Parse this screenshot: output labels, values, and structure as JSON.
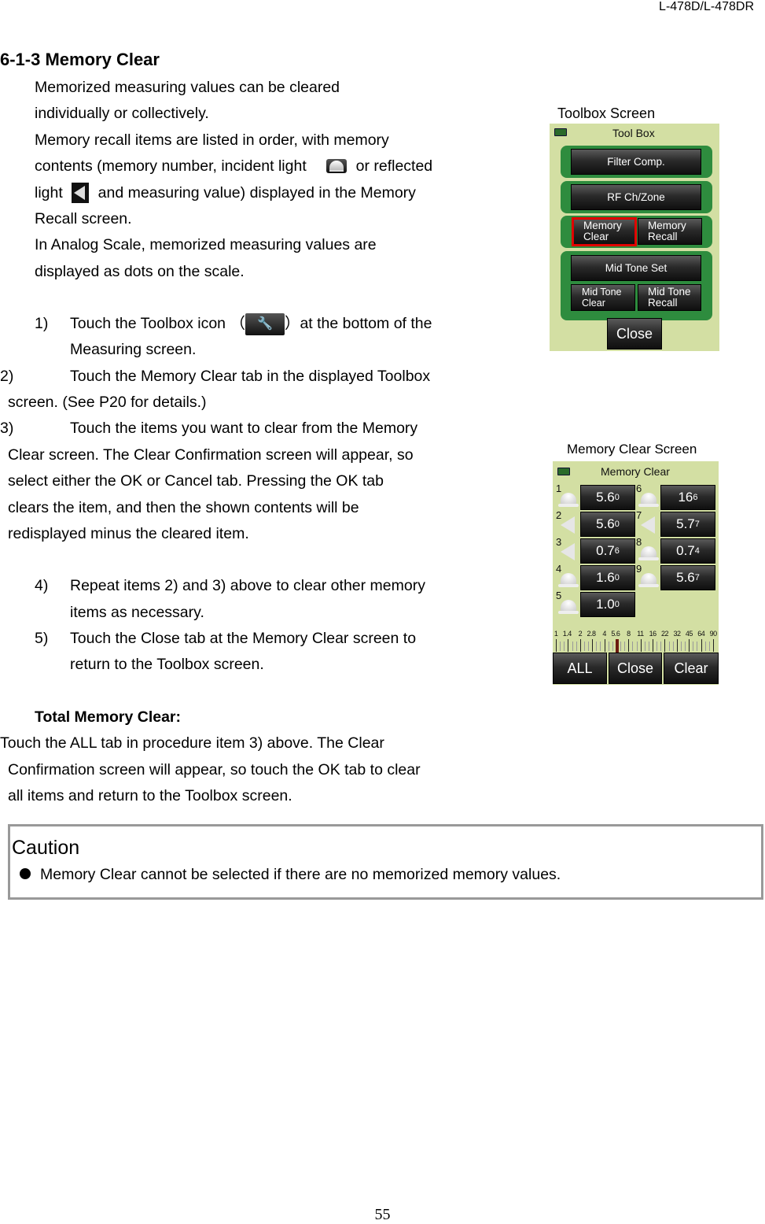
{
  "header": {
    "model": "L-478D/L-478DR"
  },
  "section": {
    "title": "6-1-3 Memory Clear"
  },
  "intro": {
    "lines": [
      "Memorized measuring values can be cleared",
      "individually or collectively.",
      "Memory recall items are listed in order, with memory"
    ],
    "line4_a": "contents (memory number, incident light",
    "line4_b": "or reflected",
    "line5_a": "light",
    "line5_b": "and measuring value) displayed in the Memory",
    "lines2": [
      "Recall screen.",
      "In Analog Scale, memorized measuring values are",
      "displayed as dots on the scale."
    ]
  },
  "icons": {
    "incident": "incident-light-icon",
    "reflected": "reflected-light-icon",
    "toolbox": "wrench-icon",
    "toolbox_glyph": "🔧"
  },
  "steps": {
    "s1_num": "1)",
    "s1_a": "Touch the Toolbox icon （",
    "s1_b": "）at the bottom of the",
    "s1_c": "Measuring screen.",
    "s2_num": "2)",
    "s2_a": "Touch the Memory Clear tab in the displayed Toolbox",
    "s2_b": "screen. (See P20 for details.)",
    "s3_num": "3)",
    "s3_a": "Touch the items you want to clear from the Memory",
    "s3_lines": [
      "Clear screen. The Clear Confirmation screen will appear, so",
      "select either the OK or Cancel tab. Pressing the OK tab",
      "clears the item, and then the shown contents will be",
      "redisplayed minus the cleared item."
    ],
    "s4_num": "4)",
    "s4_a": "Repeat items 2) and 3) above to clear other memory",
    "s4_b": "items as necessary.",
    "s5_num": "5)",
    "s5_a": "Touch the Close tab at the Memory Clear screen to",
    "s5_b": "return to the Toolbox screen."
  },
  "total": {
    "heading": "Total Memory Clear:",
    "lines": [
      "Touch the ALL tab in procedure item 3) above. The Clear",
      "Confirmation screen will appear, so touch the OK tab to clear",
      "all items and return to the Toolbox screen."
    ]
  },
  "toolbox_screen": {
    "caption": "Toolbox Screen",
    "title": "Tool Box",
    "buttons": {
      "filter": "Filter Comp.",
      "rf": "RF Ch/Zone",
      "mem_clear_1": "Memory",
      "mem_clear_2": "Clear",
      "mem_recall_1": "Memory",
      "mem_recall_2": "Recall",
      "mid_set": "Mid Tone Set",
      "mid_clear_1": "Mid Tone",
      "mid_clear_2": "Clear",
      "mid_recall_1": "Mid Tone",
      "mid_recall_2": "Recall",
      "close": "Close"
    },
    "highlighted": "Memory Clear",
    "highlight_color": "#e00000",
    "panel_color": "#d3dfa3",
    "group_color": "#2e8c3e"
  },
  "memory_clear_screen": {
    "caption": "Memory Clear Screen",
    "title": "Memory Clear",
    "items": [
      {
        "n": "1",
        "type": "incident",
        "main": "5.6",
        "sub": "0"
      },
      {
        "n": "2",
        "type": "reflected",
        "main": "5.6",
        "sub": "0"
      },
      {
        "n": "3",
        "type": "reflected",
        "main": "0.7",
        "sub": "6"
      },
      {
        "n": "4",
        "type": "incident",
        "main": "1.6",
        "sub": "0"
      },
      {
        "n": "5",
        "type": "incident",
        "main": "1.0",
        "sub": "0"
      },
      {
        "n": "6",
        "type": "incident",
        "main": "16",
        "sub": "6"
      },
      {
        "n": "7",
        "type": "reflected",
        "main": "5.7",
        "sub": "7"
      },
      {
        "n": "8",
        "type": "incident",
        "main": "0.7",
        "sub": "4"
      },
      {
        "n": "9",
        "type": "incident",
        "main": "5.6",
        "sub": "7"
      }
    ],
    "scale_labels": [
      "1",
      "1.4",
      "2",
      "2.8",
      "4",
      "5.6",
      "8",
      "11",
      "16",
      "22",
      "32",
      "45",
      "64",
      "90"
    ],
    "scale_marker": "5.6",
    "buttons": {
      "all": "ALL",
      "close": "Close",
      "clear": "Clear"
    }
  },
  "caution": {
    "title": "Caution",
    "text": "Memory Clear cannot be selected if there are no memorized memory values."
  },
  "page_number": "55"
}
